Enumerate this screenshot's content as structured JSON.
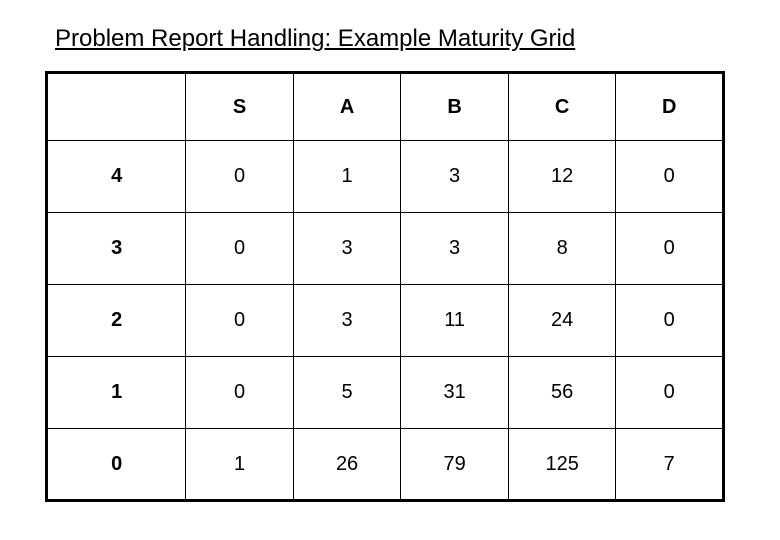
{
  "title": "Problem Report Handling: Example Maturity Grid",
  "chart_data": {
    "type": "table",
    "title": "Problem Report Handling: Example Maturity Grid",
    "columns": [
      "",
      "S",
      "A",
      "B",
      "C",
      "D"
    ],
    "rows": [
      {
        "label": "4",
        "values": [
          0,
          1,
          3,
          12,
          0
        ]
      },
      {
        "label": "3",
        "values": [
          0,
          3,
          3,
          8,
          0
        ]
      },
      {
        "label": "2",
        "values": [
          0,
          3,
          11,
          24,
          0
        ]
      },
      {
        "label": "1",
        "values": [
          0,
          5,
          31,
          56,
          0
        ]
      },
      {
        "label": "0",
        "values": [
          1,
          26,
          79,
          125,
          7
        ]
      }
    ]
  }
}
